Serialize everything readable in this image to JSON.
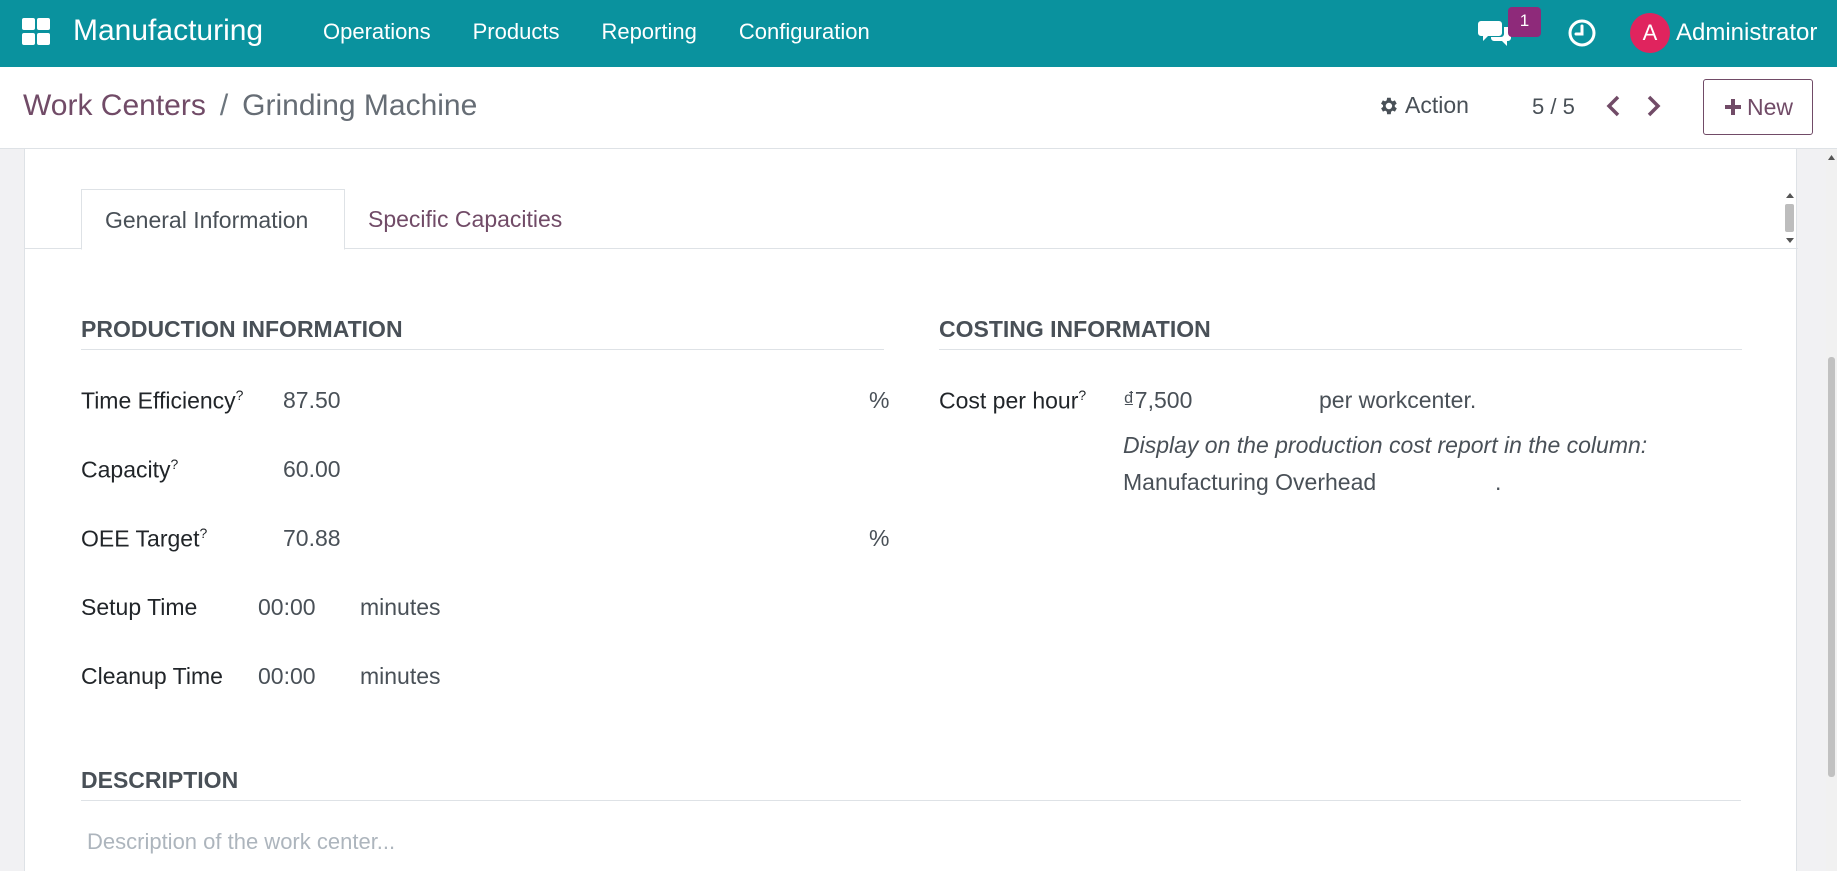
{
  "navbar": {
    "app_name": "Manufacturing",
    "menu": [
      "Operations",
      "Products",
      "Reporting",
      "Configuration"
    ],
    "chat_badge": "1",
    "user_initial": "A",
    "user_name": "Administrator"
  },
  "control_panel": {
    "breadcrumb_parent": "Work Centers",
    "breadcrumb_separator": "/",
    "breadcrumb_current": "Grinding Machine",
    "action_label": "Action",
    "pager": "5 / 5",
    "new_label": "New"
  },
  "tabs": {
    "general": "General Information",
    "capacities": "Specific Capacities"
  },
  "production": {
    "title": "PRODUCTION INFORMATION",
    "time_efficiency_label": "Time Efficiency",
    "time_efficiency_value": "87.50",
    "time_efficiency_unit": "%",
    "capacity_label": "Capacity",
    "capacity_value": "60.00",
    "oee_label": "OEE Target",
    "oee_value": "70.88",
    "oee_unit": "%",
    "setup_label": "Setup Time",
    "setup_value": "00:00",
    "setup_unit": "minutes",
    "cleanup_label": "Cleanup Time",
    "cleanup_value": "00:00",
    "cleanup_unit": "minutes",
    "help_mark": "?"
  },
  "costing": {
    "title": "COSTING INFORMATION",
    "cost_label": "Cost per hour",
    "cost_value": "₫7,500",
    "cost_suffix": "per workcenter.",
    "note": "Display on the production cost report in the column:",
    "column_value": "Manufacturing Overhead",
    "column_suffix": "."
  },
  "description": {
    "title": "DESCRIPTION",
    "placeholder": "Description of the work center..."
  },
  "colors": {
    "navbar": "#0a929e",
    "primary": "#714b67",
    "badge": "#8e2a7a",
    "avatar": "#e0245e"
  }
}
